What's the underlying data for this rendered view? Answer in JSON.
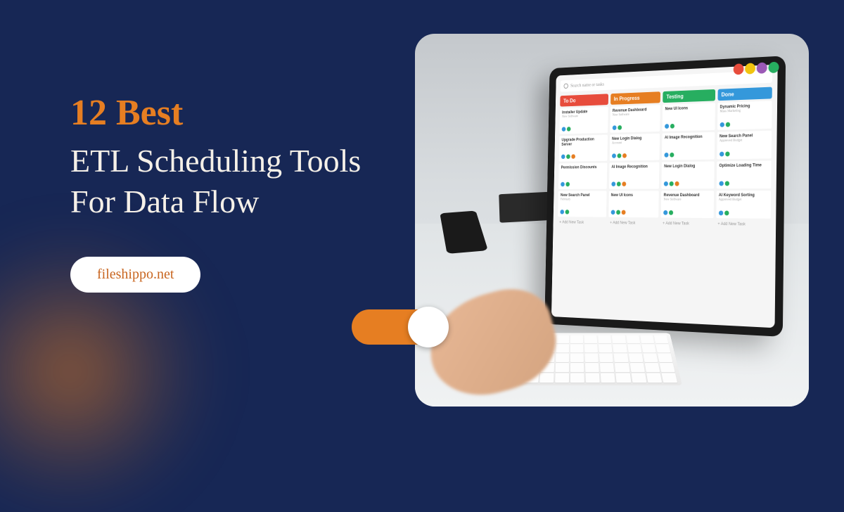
{
  "headline": {
    "accent": "12 Best",
    "main": "ETL Scheduling Tools For Data Flow"
  },
  "pill_label": "fileshippo.net",
  "tablet": {
    "search_placeholder": "Search name or tasks",
    "columns": [
      {
        "name": "To Do",
        "color_class": "col-todo",
        "cards": [
          {
            "title": "Installer Update",
            "sub": "New Software"
          },
          {
            "title": "Upgrade Production Server",
            "sub": ""
          },
          {
            "title": "Permission Discounts",
            "sub": ""
          },
          {
            "title": "New Search Panel",
            "sub": "February"
          }
        ]
      },
      {
        "name": "In Progress",
        "color_class": "col-progress",
        "cards": [
          {
            "title": "Revenue Dashboard",
            "sub": "New Software"
          },
          {
            "title": "New Login Dialog",
            "sub": "Account"
          },
          {
            "title": "AI Image Recognition",
            "sub": ""
          },
          {
            "title": "New UI Icons",
            "sub": ""
          }
        ]
      },
      {
        "name": "Testing",
        "color_class": "col-testing",
        "cards": [
          {
            "title": "New UI Icons",
            "sub": ""
          },
          {
            "title": "AI Image Recognition",
            "sub": ""
          },
          {
            "title": "New Login Dialog",
            "sub": ""
          },
          {
            "title": "Revenue Dashboard",
            "sub": "New Software"
          }
        ]
      },
      {
        "name": "Done",
        "color_class": "col-done",
        "cards": [
          {
            "title": "Dynamic Pricing",
            "sub": "Mass Marketing"
          },
          {
            "title": "New Search Panel",
            "sub": "Approved Budget"
          },
          {
            "title": "Optimize Loading Time",
            "sub": ""
          },
          {
            "title": "AI Keyword Sorting",
            "sub": "Approved Budget"
          }
        ]
      }
    ],
    "add_task_label": "+ Add New Task",
    "avatar_colors": [
      "#e74c3c",
      "#f1c40f",
      "#9b59b6",
      "#27ae60"
    ]
  },
  "dot_colors": [
    "#3498db",
    "#27ae60",
    "#e67e22"
  ],
  "colors": {
    "background": "#172755",
    "accent": "#e67e22",
    "text": "#f5f0e8"
  }
}
